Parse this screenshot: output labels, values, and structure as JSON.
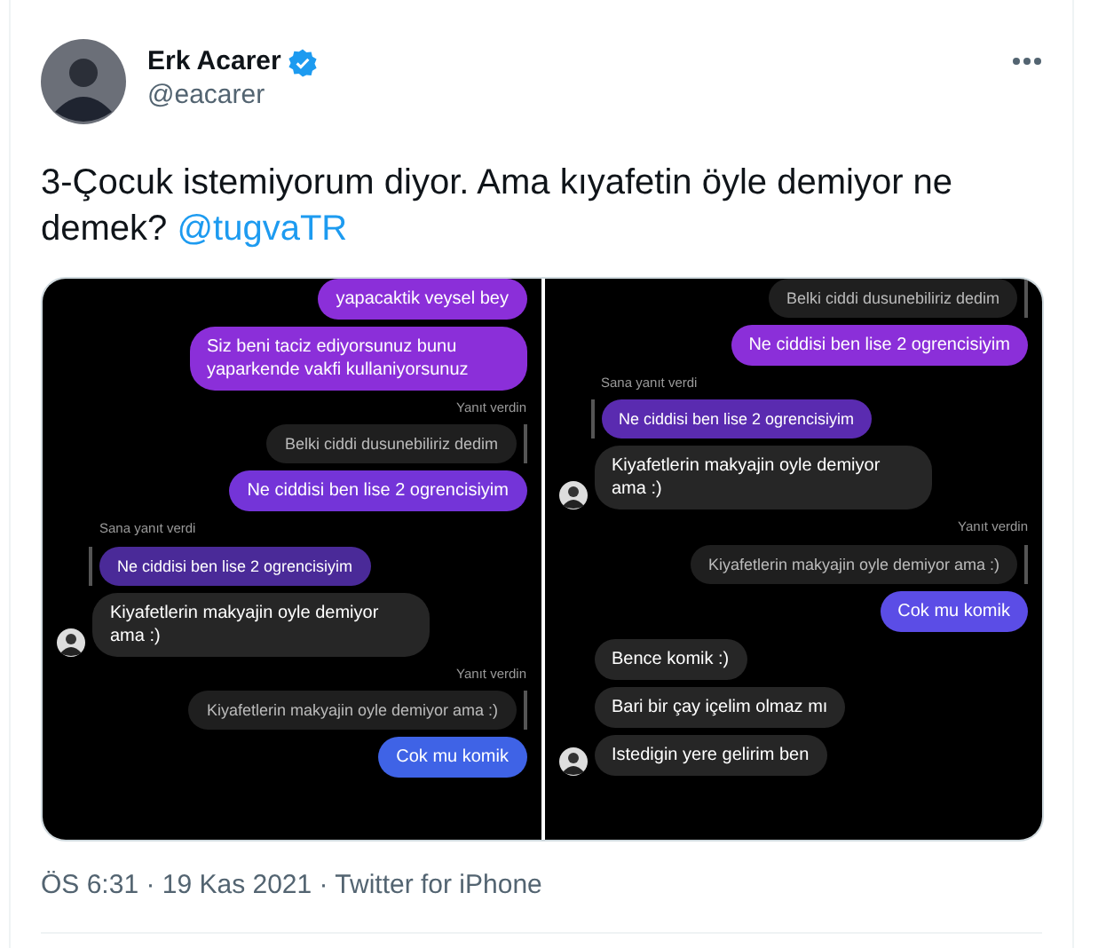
{
  "author": {
    "name": "Erk Acarer",
    "handle": "@eacarer",
    "verified": true
  },
  "tweet": {
    "text": "3-Çocuk istemiyorum diyor. Ama kıyafetin öyle demiyor ne demek?",
    "mention": "@tugvaTR"
  },
  "images": [
    {
      "messages": [
        {
          "kind": "sent",
          "text": "yapacaktik veysel  bey",
          "color": "#8b2fd9"
        },
        {
          "kind": "sent",
          "text": "Siz beni taciz ediyorsunuz bunu yaparkende vakfi kullaniyorsunuz",
          "color": "#8b2fd9"
        },
        {
          "kind": "label",
          "own": true,
          "text": "Yanıt verdin"
        },
        {
          "kind": "quote",
          "own": true,
          "text": "Belki ciddi dusunebiliriz dedim",
          "color": "#1f1f1f"
        },
        {
          "kind": "sent",
          "text": "Ne ciddisi ben lise 2 ogrencisiyim",
          "color": "#7434d8"
        },
        {
          "kind": "label",
          "own": false,
          "text": "Sana yanıt verdi"
        },
        {
          "kind": "quote",
          "own": false,
          "text": "Ne ciddisi ben lise 2 ogrencisiyim",
          "color": "#4a2a98"
        },
        {
          "kind": "received",
          "text": "Kiyafetlerin makyajin oyle demiyor ama :)",
          "avatar": true
        },
        {
          "kind": "label",
          "own": true,
          "text": "Yanıt verdin"
        },
        {
          "kind": "quote",
          "own": true,
          "text": "Kiyafetlerin makyajin oyle demiyor ama :)",
          "color": "#1f1f1f"
        },
        {
          "kind": "sent",
          "text": "Cok mu komik",
          "color": "#3f63e6"
        }
      ]
    },
    {
      "messages": [
        {
          "kind": "quote",
          "own": true,
          "text": "Belki ciddi dusunebiliriz dedim",
          "color": "#1f1f1f"
        },
        {
          "kind": "sent",
          "text": "Ne ciddisi ben lise 2 ogrencisiyim",
          "color": "#8b2fd9"
        },
        {
          "kind": "label",
          "own": false,
          "text": "Sana yanıt verdi"
        },
        {
          "kind": "quote",
          "own": false,
          "text": "Ne ciddisi ben lise 2 ogrencisiyim",
          "color": "#5a2bb0"
        },
        {
          "kind": "received",
          "text": "Kiyafetlerin makyajin oyle demiyor ama :)",
          "avatar": true
        },
        {
          "kind": "label",
          "own": true,
          "text": "Yanıt verdin"
        },
        {
          "kind": "quote",
          "own": true,
          "text": "Kiyafetlerin makyajin oyle demiyor ama :)",
          "color": "#1f1f1f"
        },
        {
          "kind": "sent",
          "text": "Cok mu komik",
          "color": "#5b4de6"
        },
        {
          "kind": "received",
          "text": "Bence komik :)",
          "avatar": false
        },
        {
          "kind": "received",
          "text": "Bari bir çay içelim olmaz mı",
          "avatar": false
        },
        {
          "kind": "received",
          "text": "Istedigin yere gelirim ben",
          "avatar": true
        }
      ]
    }
  ],
  "meta": "ÖS 6:31 · 19 Kas 2021 · Twitter for iPhone"
}
